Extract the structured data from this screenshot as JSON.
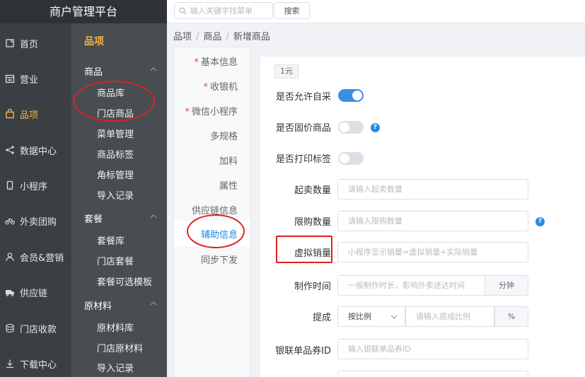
{
  "app": {
    "title": "商户管理平台"
  },
  "nav": [
    {
      "label": "首页",
      "icon": "home-icon"
    },
    {
      "label": "营业",
      "icon": "calendar-icon"
    },
    {
      "label": "品项",
      "icon": "bag-icon",
      "active": true
    },
    {
      "label": "数据中心",
      "icon": "share-icon"
    },
    {
      "label": "小程序",
      "icon": "phone-icon"
    },
    {
      "label": "外卖团购",
      "icon": "bike-icon"
    },
    {
      "label": "会员&营销",
      "icon": "user-icon"
    },
    {
      "label": "供应链",
      "icon": "truck-icon"
    },
    {
      "label": "门店收款",
      "icon": "database-icon"
    },
    {
      "label": "下载中心",
      "icon": "download-icon"
    }
  ],
  "subnav": {
    "title": "品项",
    "groups": [
      {
        "label": "商品",
        "items": [
          "商品库",
          "门店商品",
          "菜单管理",
          "商品标签",
          "角标管理",
          "导入记录"
        ]
      },
      {
        "label": "套餐",
        "items": [
          "套餐库",
          "门店套餐",
          "套餐可选模板"
        ]
      },
      {
        "label": "原材料",
        "items": [
          "原材料库",
          "门店原材料",
          "导入记录"
        ]
      }
    ]
  },
  "search": {
    "placeholder": "输入关键字找菜单",
    "button": "搜索"
  },
  "breadcrumb": [
    "品项",
    "商品",
    "新增商品"
  ],
  "tabs": [
    {
      "label": "基本信息",
      "required": true
    },
    {
      "label": "收银机",
      "required": true
    },
    {
      "label": "微信小程序",
      "required": true
    },
    {
      "label": "多规格",
      "required": false
    },
    {
      "label": "加料",
      "required": false
    },
    {
      "label": "属性",
      "required": false
    },
    {
      "label": "供应链信息",
      "required": false
    },
    {
      "label": "辅助信息",
      "required": false,
      "active": true
    },
    {
      "label": "同步下发",
      "required": false
    }
  ],
  "form": {
    "price_tag": "1元",
    "allow_self_purchase": {
      "label": "是否允许自采",
      "on": true
    },
    "fixed_price": {
      "label": "是否固价商品",
      "on": false
    },
    "print_label": {
      "label": "是否打印标签",
      "on": false
    },
    "min_qty": {
      "label": "起卖数量",
      "placeholder": "请输入起卖数量"
    },
    "limit_qty": {
      "label": "限购数量",
      "placeholder": "请输入限购数量"
    },
    "virtual_sales": {
      "label": "虚拟销量",
      "placeholder": "小程序显示销量=虚拟销量+实际销量"
    },
    "make_time": {
      "label": "制作时间",
      "placeholder": "一般制作时长，影响外卖送达时间",
      "unit": "分钟"
    },
    "commission": {
      "label": "提成",
      "mode": "按比例",
      "placeholder": "请输入提成比例",
      "unit": "%"
    },
    "unionpay_id": {
      "label": "银联单品券ID",
      "placeholder": "输入银联单品券ID"
    }
  },
  "colors": {
    "accent": "#3a8ee6",
    "active_nav": "#f5b642",
    "annotation": "#e02020"
  }
}
